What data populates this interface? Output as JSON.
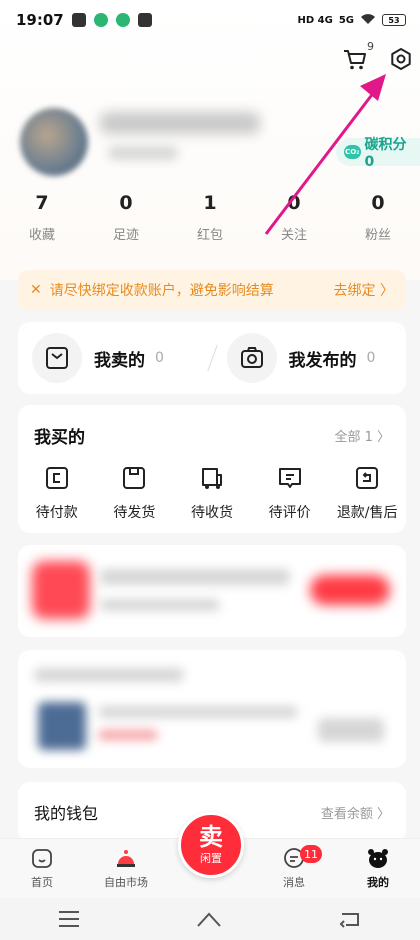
{
  "status_bar": {
    "time": "19:07",
    "network_1": "HD 4G",
    "network_2": "5G",
    "battery": "53"
  },
  "header": {
    "cart_count": "9"
  },
  "profile": {
    "carbon_label": "碳积分0",
    "co2_icon_text": "CO₂"
  },
  "stats": [
    {
      "value": "7",
      "label": "收藏"
    },
    {
      "value": "0",
      "label": "足迹"
    },
    {
      "value": "1",
      "label": "红包"
    },
    {
      "value": "0",
      "label": "关注"
    },
    {
      "value": "0",
      "label": "粉丝"
    }
  ],
  "notice": {
    "message": "请尽快绑定收款账户，避免影响结算",
    "action": "去绑定 〉"
  },
  "selling": {
    "sold_label": "我卖的",
    "sold_count": "0",
    "published_label": "我发布的",
    "published_count": "0"
  },
  "bought": {
    "title": "我买的",
    "all_label": "全部 1 〉",
    "items": [
      {
        "label": "待付款",
        "icon": "wallet-icon"
      },
      {
        "label": "待发货",
        "icon": "package-icon"
      },
      {
        "label": "待收货",
        "icon": "truck-icon"
      },
      {
        "label": "待评价",
        "icon": "comment-icon"
      },
      {
        "label": "退款/售后",
        "icon": "refund-icon"
      }
    ]
  },
  "wallet": {
    "title": "我的钱包",
    "link": "查看余额 〉"
  },
  "tabbar": {
    "tabs": [
      {
        "label": "首页",
        "icon": "home-icon"
      },
      {
        "label": "自由市场",
        "icon": "market-icon"
      },
      {
        "label": "",
        "icon": "sell-icon"
      },
      {
        "label": "消息",
        "icon": "message-icon",
        "badge": "11"
      },
      {
        "label": "我的",
        "icon": "profile-icon"
      }
    ],
    "sell_big": "卖",
    "sell_small": "闲置"
  },
  "colors": {
    "accent_red": "#ff2d3a",
    "carbon_green": "#1aa38a",
    "notice_orange": "#e88b1f",
    "arrow_magenta": "#e0188a"
  }
}
